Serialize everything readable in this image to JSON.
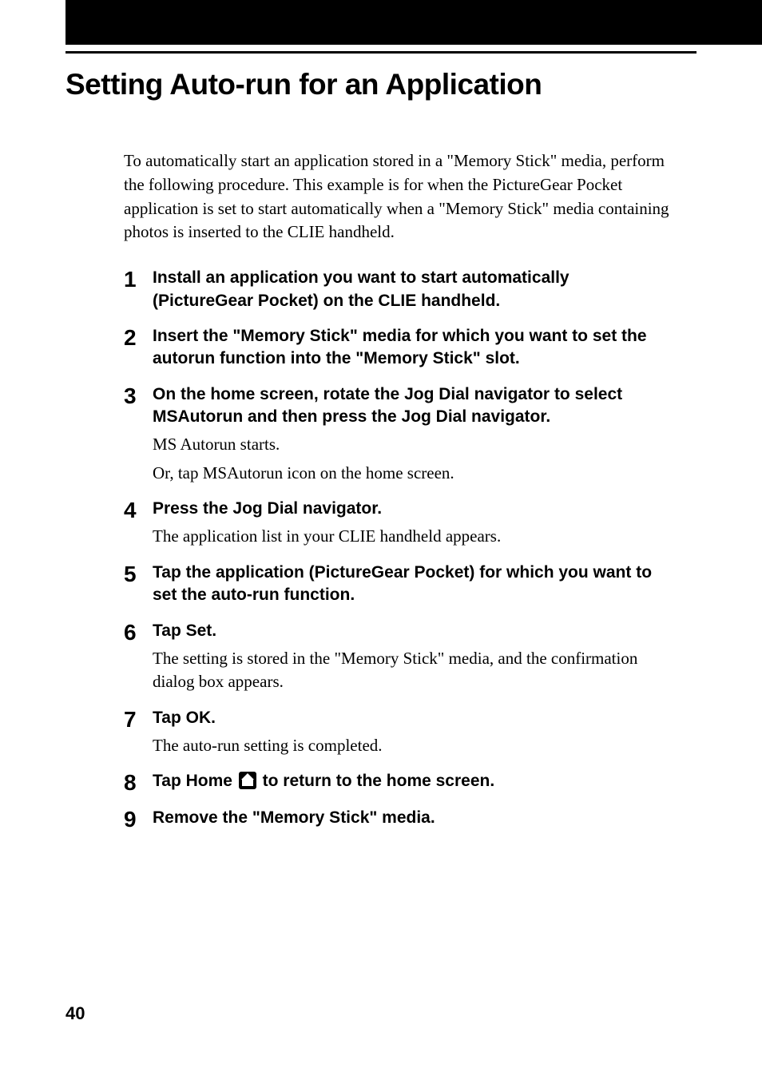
{
  "title": "Setting Auto-run for an Application",
  "intro": "To automatically start an application stored in a \"Memory Stick\" media, perform the following procedure. This example is for when the PictureGear Pocket application is set to start automatically when a \"Memory Stick\" media containing photos is inserted to the CLIE handheld.",
  "steps": [
    {
      "num": "1",
      "head": "Install an application you want to start automatically (PictureGear Pocket) on the CLIE handheld."
    },
    {
      "num": "2",
      "head": "Insert the \"Memory Stick\" media for which you want to set the autorun function into the \"Memory Stick\" slot."
    },
    {
      "num": "3",
      "head": "On the home screen, rotate the Jog Dial navigator to select MSAutorun and then press the Jog Dial navigator.",
      "desc1": "MS Autorun starts.",
      "desc2": "Or, tap MSAutorun icon on the home screen."
    },
    {
      "num": "4",
      "head": "Press the Jog Dial navigator.",
      "desc1": "The application list in your CLIE handheld appears."
    },
    {
      "num": "5",
      "head": "Tap the application (PictureGear Pocket) for which you want to set the auto-run function."
    },
    {
      "num": "6",
      "head": "Tap Set.",
      "desc1": "The setting is stored in the \"Memory Stick\" media, and the confirmation dialog box appears."
    },
    {
      "num": "7",
      "head": "Tap OK.",
      "desc1": "The auto-run setting is completed."
    },
    {
      "num": "8",
      "head_pre": "Tap Home ",
      "head_post": " to return to the home screen."
    },
    {
      "num": "9",
      "head": "Remove the \"Memory Stick\" media."
    }
  ],
  "page_number": "40"
}
